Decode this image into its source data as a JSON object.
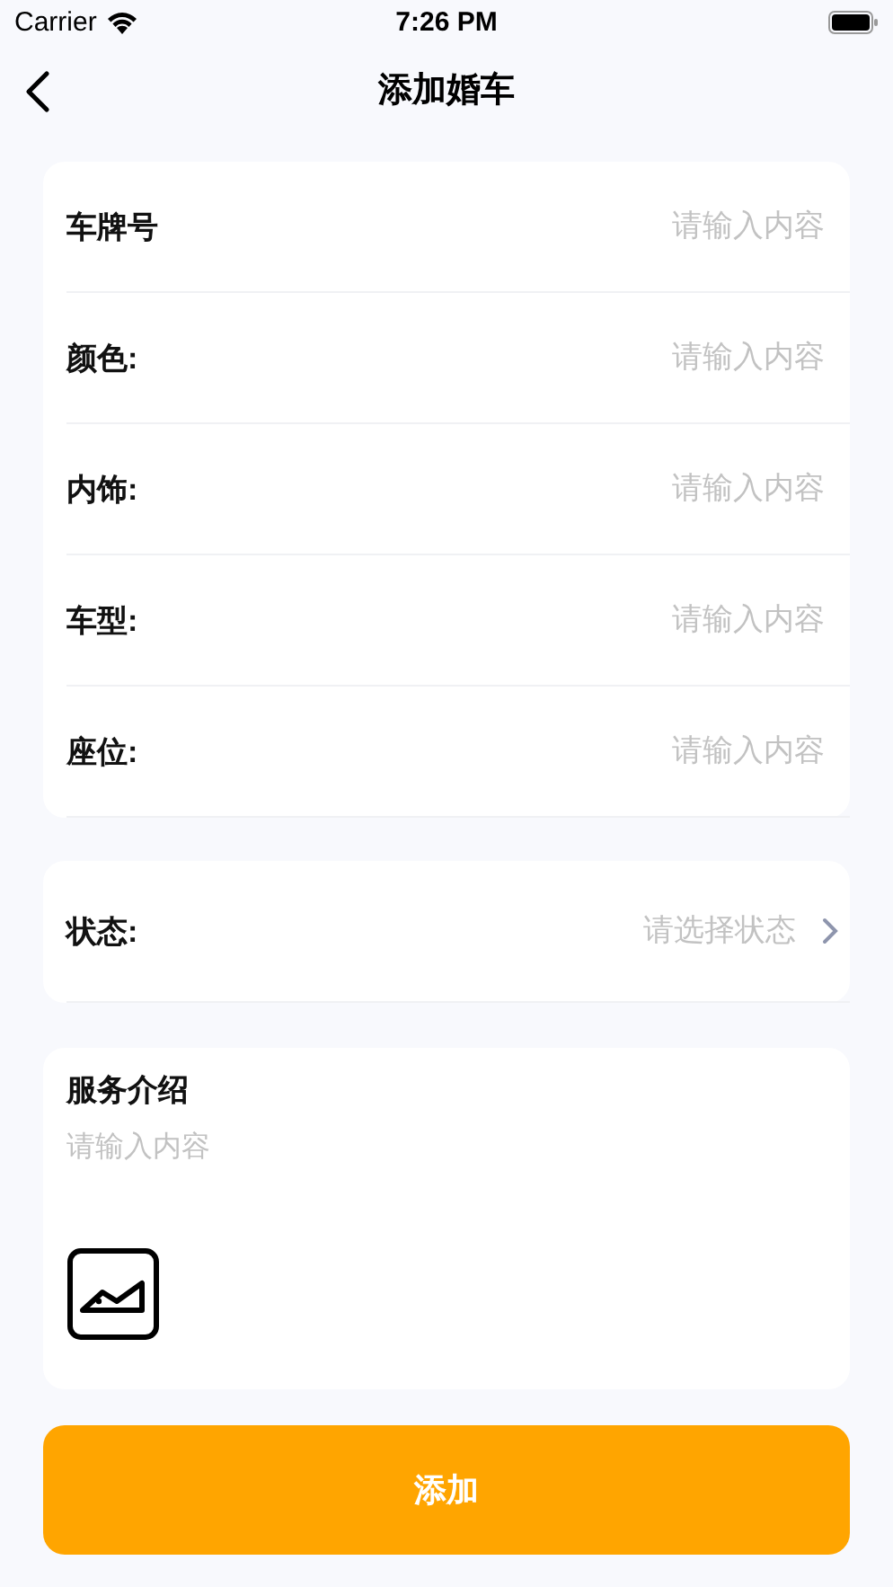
{
  "status_bar": {
    "carrier": "Carrier",
    "time": "7:26 PM"
  },
  "nav": {
    "title": "添加婚车"
  },
  "fields": [
    {
      "label": "车牌号",
      "placeholder": "请输入内容"
    },
    {
      "label": "颜色:",
      "placeholder": "请输入内容"
    },
    {
      "label": "内饰:",
      "placeholder": "请输入内容"
    },
    {
      "label": "车型:",
      "placeholder": "请输入内容"
    },
    {
      "label": "座位:",
      "placeholder": "请输入内容"
    }
  ],
  "status_select": {
    "label": "状态:",
    "placeholder": "请选择状态"
  },
  "service_intro": {
    "label": "服务介绍",
    "placeholder": "请输入内容"
  },
  "submit_button": "添加"
}
